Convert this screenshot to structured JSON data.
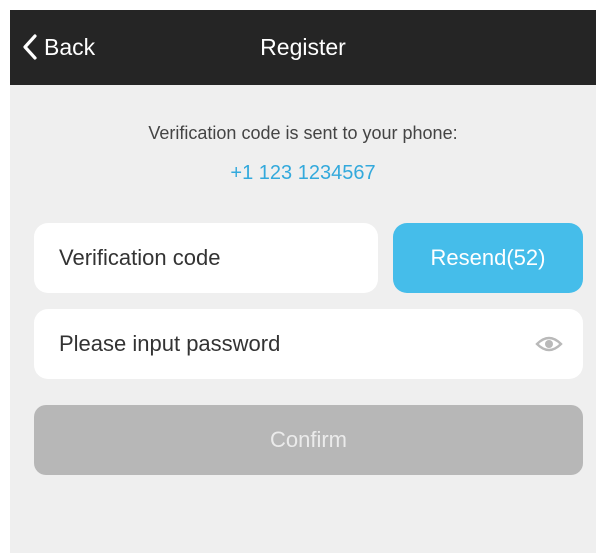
{
  "navbar": {
    "back_label": "Back",
    "back_icon": "chevron-left-icon",
    "title": "Register"
  },
  "info": {
    "message": "Verification code is sent to your phone:",
    "phone": "+1 123 1234567"
  },
  "form": {
    "code_placeholder": "Verification code",
    "resend_label": "Resend(52)",
    "password_placeholder": "Please input password",
    "eye_icon": "eye-icon",
    "confirm_label": "Confirm"
  },
  "colors": {
    "navbar": "#252525",
    "accent": "#45bdea",
    "phone_text": "#33a9dc",
    "background": "#efefef",
    "disabled_button": "#b7b7b7"
  }
}
